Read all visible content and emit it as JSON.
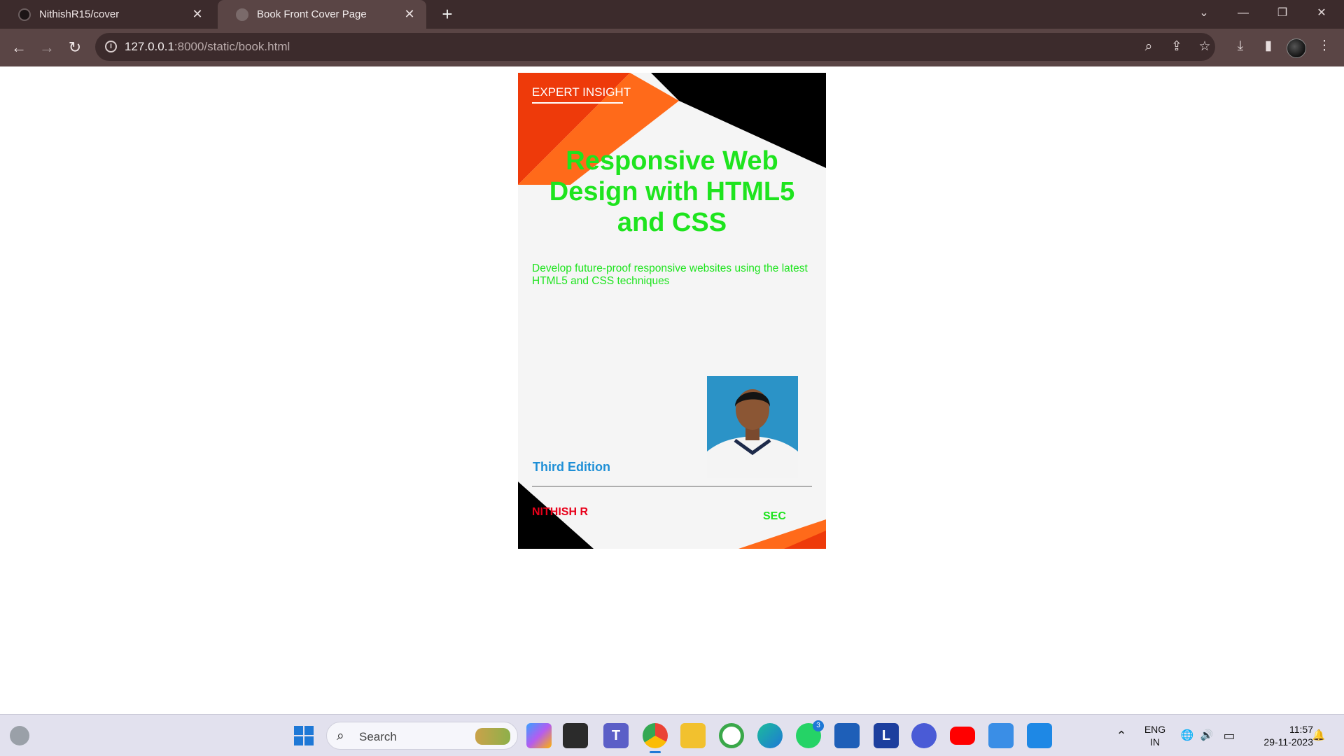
{
  "browser": {
    "tabs": [
      {
        "title": "NithishR15/cover",
        "close": "✕"
      },
      {
        "title": "Book Front Cover Page",
        "close": "✕"
      }
    ],
    "new_tab": "+",
    "window_controls": {
      "minimize": "—",
      "restore": "❐",
      "close": "✕",
      "tab_search": "⌄"
    },
    "nav": {
      "back": "←",
      "forward": "→",
      "reload": "↻"
    },
    "address": {
      "host": "127.0.0.1",
      "rest": ":8000/static/book.html",
      "info": "i"
    },
    "toolbar_icons": {
      "zoom": "⌕",
      "share": "⇪",
      "bookmark": "☆",
      "download": "⤓",
      "sidepanel": "▮",
      "menu": "⋮"
    }
  },
  "cover": {
    "eyebrow": "EXPERT INSIGHT",
    "title": "Responsive Web Design with HTML5 and CSS",
    "tagline": "Develop future-proof responsive websites using the latest HTML5 and CSS techniques",
    "edition": "Third Edition",
    "author": "NITHISH R",
    "publisher": "SEC",
    "colors": {
      "accent_orange": "#ff6a1a",
      "accent_red": "#ee3a0a",
      "title_green": "#1ee41e",
      "edition_blue": "#1e8fd6",
      "author_red": "#e8001a"
    }
  },
  "taskbar": {
    "search_placeholder": "Search",
    "search_icon": "⌕",
    "whatsapp_badge": "3",
    "apps": [
      "windows-start",
      "copilot-pre",
      "terminal",
      "teams",
      "chrome",
      "file-explorer",
      "app-circle",
      "edge",
      "whatsapp",
      "microsoft-store",
      "l-app",
      "vivaldi-like",
      "youtube",
      "notepad",
      "vscode"
    ],
    "tray": {
      "chevron": "⌃",
      "lang_top": "ENG",
      "lang_bottom": "IN",
      "time": "11:57",
      "date": "29-11-2023",
      "network_icon": "🌐",
      "volume_icon": "🔊",
      "battery_icon": "▭",
      "bell_icon": "🔔"
    }
  }
}
